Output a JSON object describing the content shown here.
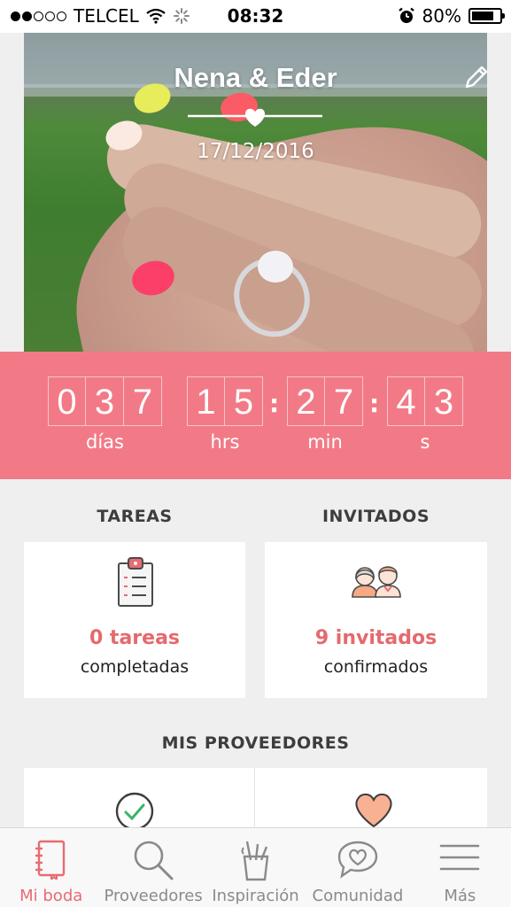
{
  "status_bar": {
    "carrier": "TELCEL",
    "time": "08:32",
    "battery_percent": "80%",
    "battery_level": 0.8,
    "signal_dots_filled": 2,
    "signal_dots_total": 5
  },
  "hero": {
    "couple_names": "Nena & Eder",
    "date": "17/12/2016"
  },
  "countdown": {
    "days": [
      "0",
      "3",
      "7"
    ],
    "hours": [
      "1",
      "5"
    ],
    "minutes": [
      "2",
      "7"
    ],
    "seconds": [
      "4",
      "3"
    ],
    "separator": ":",
    "labels": {
      "days": "días",
      "hours": "hrs",
      "minutes": "min",
      "seconds": "s"
    }
  },
  "sections": {
    "tasks": {
      "title": "TAREAS",
      "count_text": "0 tareas",
      "sub_text": "completadas",
      "icon": "clipboard-checklist-icon"
    },
    "guests": {
      "title": "INVITADOS",
      "count_text": "9 invitados",
      "sub_text": "confirmados",
      "icon": "couple-icon"
    },
    "vendors": {
      "title": "MIS PROVEEDORES",
      "icons": [
        "check-circle-icon",
        "heart-icon"
      ]
    }
  },
  "tabbar": {
    "items": [
      {
        "label": "Mi boda",
        "icon": "notebook-icon",
        "active": true
      },
      {
        "label": "Proveedores",
        "icon": "search-icon",
        "active": false
      },
      {
        "label": "Inspiración",
        "icon": "paint-cup-icon",
        "active": false
      },
      {
        "label": "Comunidad",
        "icon": "chat-heart-icon",
        "active": false
      },
      {
        "label": "Más",
        "icon": "menu-icon",
        "active": false
      }
    ]
  },
  "colors": {
    "accent": "#f27a87",
    "accent_text": "#e46a6e",
    "background": "#efefef"
  }
}
